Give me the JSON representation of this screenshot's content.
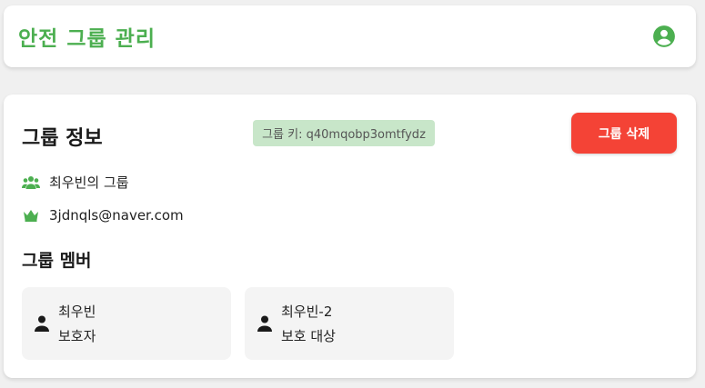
{
  "header": {
    "title": "안전 그룹 관리",
    "profile_icon": "account-circle-icon"
  },
  "group_info": {
    "title": "그룹 정보",
    "group_key": "그룹 키: q40mqobp3omtfydz",
    "delete_label": "그룹 삭제",
    "group_name": "최우빈의 그룹",
    "owner_email": "3jdnqls@naver.com",
    "group_icon": "group-icon",
    "owner_icon": "crown-icon"
  },
  "members": {
    "title": "그룹 멤버",
    "items": [
      {
        "name": "최우빈",
        "role": "보호자",
        "icon": "person-icon"
      },
      {
        "name": "최우빈-2",
        "role": "보호 대상",
        "icon": "person-icon"
      }
    ]
  },
  "colors": {
    "accent": "#4caf50",
    "danger": "#f44336",
    "key_badge": "#c8e6c9"
  }
}
